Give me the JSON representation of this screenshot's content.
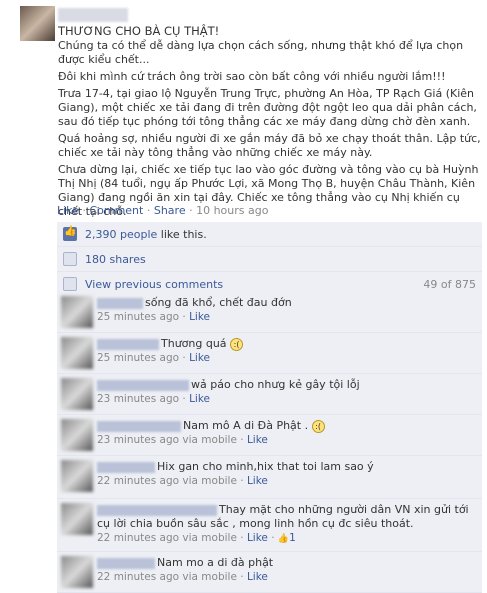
{
  "post": {
    "title": "THƯƠNG CHO BÀ CỤ THẬT!",
    "paragraphs": [
      "Chúng ta có thể dễ dàng lựa chọn cách sống, nhưng thật khó để lựa chọn được kiểu chết...",
      "Đôi khi mình cứ trách ông trời sao còn bất công với nhiều người lắm!!!",
      "Trưa 17-4, tại giao lộ Nguyễn Trung Trực, phường An Hòa, TP Rạch Giá (Kiên Giang), một chiếc xe tải đang đi trên đường đột ngột leo qua dải phân cách, sau đó tiếp tục phóng tới tông thẳng các xe máy đang dừng chờ đèn xanh.",
      "Quá hoảng sợ, nhiều người đi xe gắn máy đã bỏ xe chạy thoát thân. Lập tức, chiếc xe tải này tông thẳng vào những chiếc xe máy này.",
      "Chưa dừng lại, chiếc xe tiếp tục lao vào góc đường và tông vào cụ bà Huỳnh Thị Nhị (84 tuổi, ngụ ấp Phước Lợi, xã Mong Thọ B, huyện Châu Thành, Kiên Giang) đang ngồi ăn xin tại đây. Chiếc xe tông thẳng vào cụ Nhị khiến cụ chết tại chỗ."
    ],
    "actions": {
      "like": "Like",
      "comment": "Comment",
      "share": "Share",
      "time": "10 hours ago",
      "sep": " · "
    }
  },
  "ufi": {
    "likes_count": "2,390 people",
    "likes_suffix": " like this.",
    "shares": "180 shares",
    "view_previous": "View previous comments",
    "comment_count": "49 of 875"
  },
  "comments": [
    {
      "text": "sống đã khổ, chết đau đớn",
      "time": "25 minutes ago",
      "via": "",
      "like": "Like",
      "likes": "",
      "emoticon": ""
    },
    {
      "text": "Thương quá",
      "time": "25 minutes ago",
      "via": "",
      "like": "Like",
      "likes": "",
      "emoticon": ":("
    },
    {
      "text": "wả páo cho nhưg kẻ gây tội lỗj",
      "time": "23 minutes ago",
      "via": "",
      "like": "Like",
      "likes": "",
      "emoticon": ""
    },
    {
      "text": "Nam mô A di Đà Phật .",
      "time": "23 minutes ago",
      "via": " via mobile",
      "like": "Like",
      "likes": "",
      "emoticon": ":("
    },
    {
      "text": "Hix gan cho minh,hix that toi lam sao ý",
      "time": "22 minutes ago",
      "via": " via mobile",
      "like": "Like",
      "likes": "",
      "emoticon": ""
    },
    {
      "text": "Thay mặt cho những người dân VN xin gửi tới cụ lời chia buồn sâu sắc , mong linh hồn cụ đc siêu thoát.",
      "time": "22 minutes ago",
      "via": " via mobile",
      "like": "Like",
      "likes": "1",
      "emoticon": ""
    },
    {
      "text": "Nam mo a di đà phật",
      "time": "22 minutes ago",
      "via": " via mobile",
      "like": "Like",
      "likes": "",
      "emoticon": ""
    }
  ],
  "colors": {
    "link": "#3b5998",
    "ufi_bg": "#edeff4",
    "meta": "#888888"
  },
  "icons": {
    "like": "thumbs-up-icon",
    "share": "share-icon",
    "view_previous": "comment-icon",
    "emoticon": "frown-emoticon-icon"
  }
}
